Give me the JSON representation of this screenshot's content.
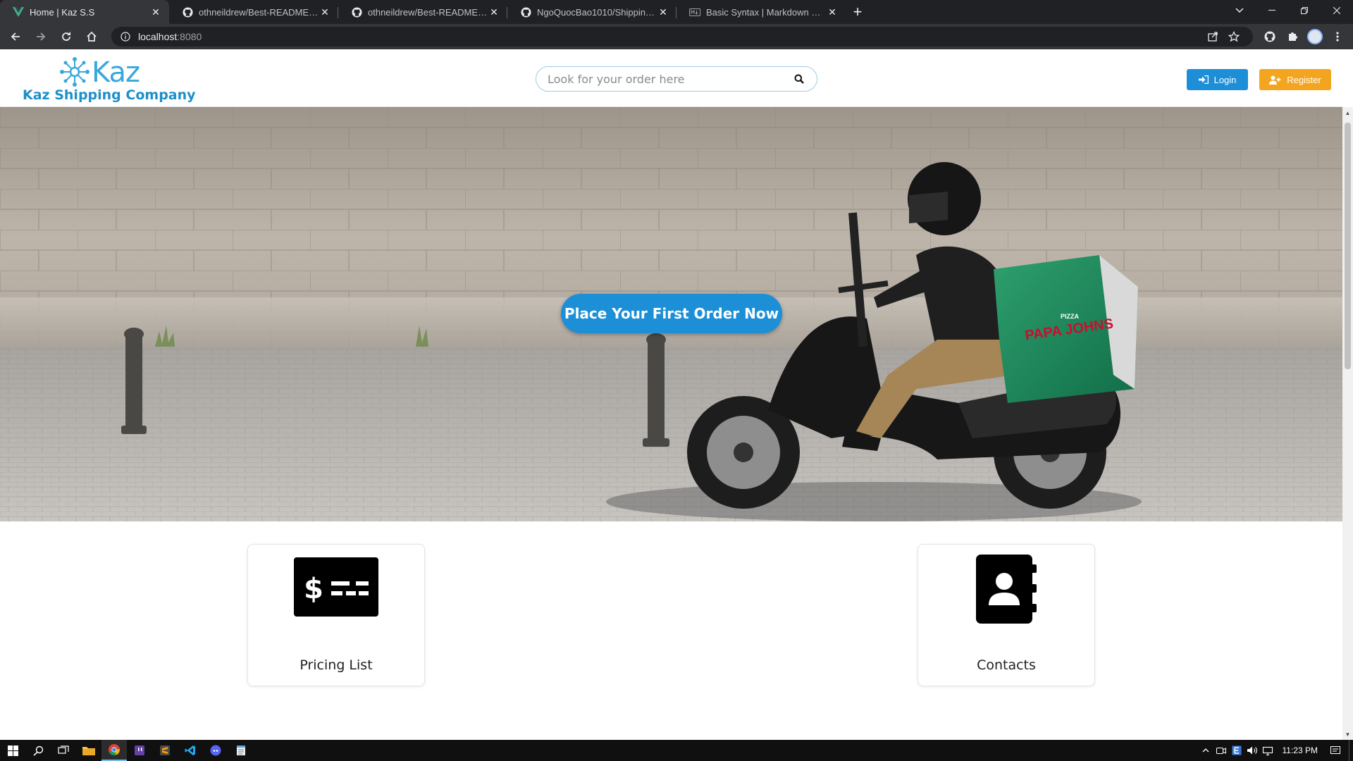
{
  "browser": {
    "tabs": [
      {
        "title": "Home | Kaz S.S",
        "favicon": "vue-icon",
        "active": true
      },
      {
        "title": "othneildrew/Best-README-Temp",
        "favicon": "github-icon",
        "active": false
      },
      {
        "title": "othneildrew/Best-README-Temp",
        "favicon": "github-icon",
        "active": false
      },
      {
        "title": "NgoQuocBao1010/Shipping-Syst",
        "favicon": "github-icon",
        "active": false
      },
      {
        "title": "Basic Syntax | Markdown Guide",
        "favicon": "markdown-icon",
        "active": false
      }
    ],
    "url_host": "localhost",
    "url_port": ":8080"
  },
  "site": {
    "logo_word": "Kaz",
    "logo_subtitle": "Kaz Shipping Company",
    "search_placeholder": "Look for your order here",
    "login_label": "Login",
    "register_label": "Register",
    "cta_label": "Place Your First Order Now",
    "box_brand": "PAPA JOHNS",
    "box_small": "PIZZA",
    "cards": [
      {
        "label": "Pricing List",
        "icon": "money-bill-icon"
      },
      {
        "label": "Contacts",
        "icon": "address-book-icon"
      }
    ]
  },
  "taskbar": {
    "time": "11:23 PM"
  },
  "colors": {
    "brand_blue": "#1c8fd6",
    "register_orange": "#f3a51f",
    "logo_blue": "#38a8dc"
  }
}
